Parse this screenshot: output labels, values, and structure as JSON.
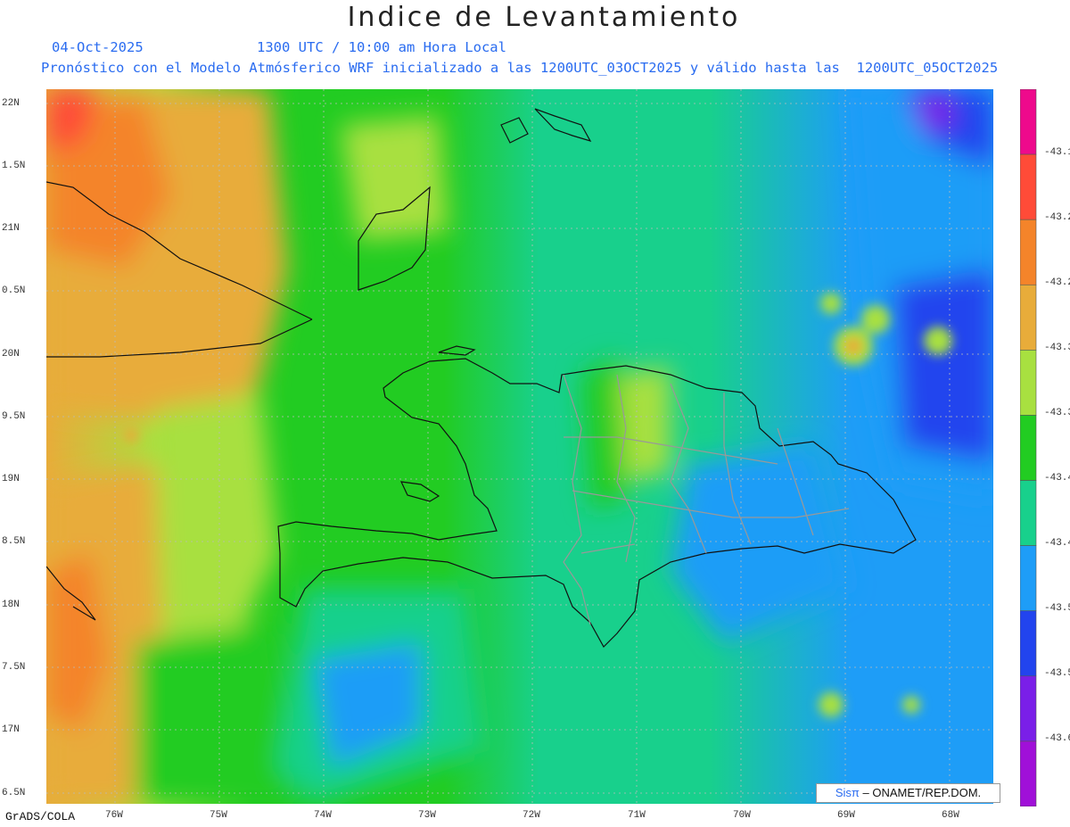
{
  "header": {
    "title": "Indice de Levantamiento",
    "date": "04-Oct-2025",
    "time": "1300 UTC / 10:00 am Hora Local",
    "description": "Pronóstico con el Modelo Atmósferico WRF inicializado a las 1200UTC_03OCT2025 y válido hasta las  1200UTC_05OCT2025"
  },
  "axes": {
    "lat_labels": [
      "22N",
      "1.5N",
      "21N",
      "0.5N",
      "20N",
      "9.5N",
      "19N",
      "8.5N",
      "18N",
      "7.5N",
      "17N",
      "6.5N"
    ],
    "lon_labels": [
      "76W",
      "75W",
      "74W",
      "73W",
      "72W",
      "71W",
      "70W",
      "69W",
      "68W"
    ]
  },
  "colorbar": {
    "labels": [
      "-43.1",
      "-43.2",
      "-43.2",
      "-43.3",
      "-43.3",
      "-43.4",
      "-43.4",
      "-43.5",
      "-43.5",
      "-43.6"
    ],
    "colors": [
      "#ee0a8c",
      "#ff4b38",
      "#f4842a",
      "#e8ac3a",
      "#a8e040",
      "#22cc22",
      "#18d08c",
      "#1e9df7",
      "#2244ee",
      "#7a1fe8",
      "#a010d8"
    ]
  },
  "footer": {
    "software": "GrADS/COLA"
  },
  "credit": {
    "logo": "Sisπ",
    "text": "– ONAMET/REP.DOM."
  }
}
